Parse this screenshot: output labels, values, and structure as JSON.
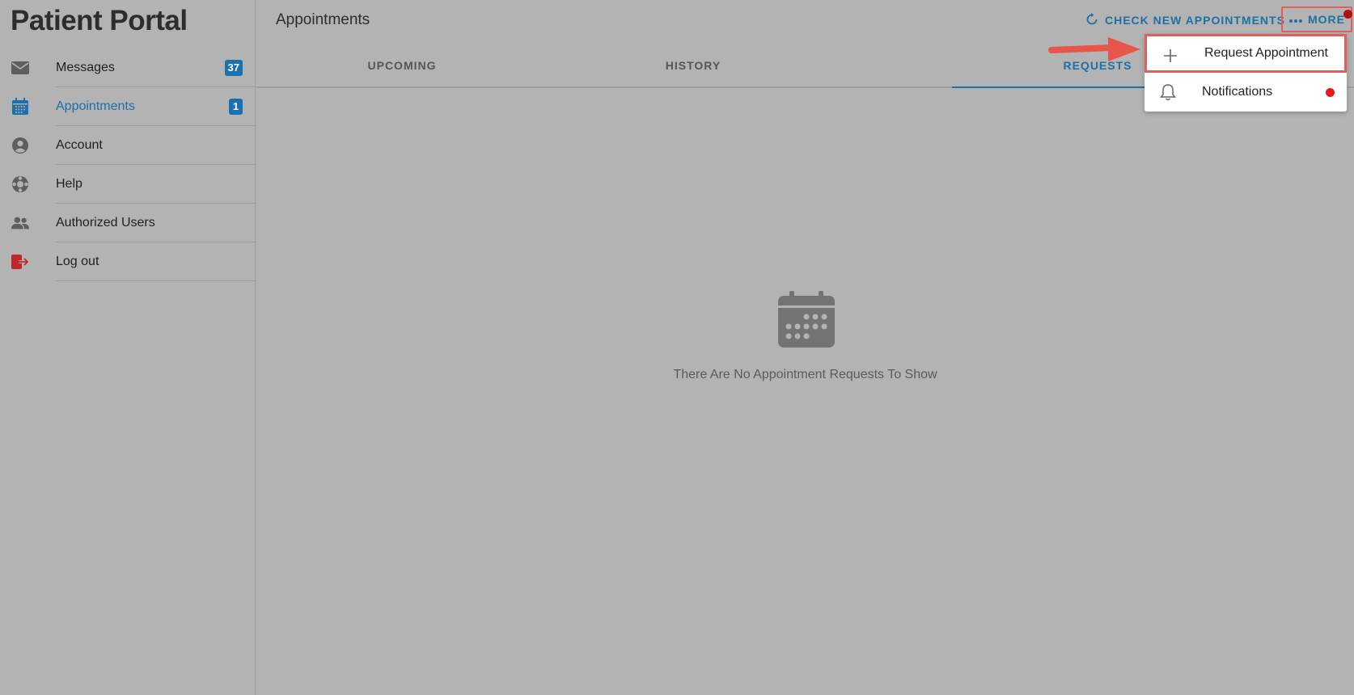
{
  "app": {
    "title": "Patient Portal"
  },
  "sidebar": {
    "items": [
      {
        "label": "Messages",
        "icon": "envelope-icon",
        "badge": "37",
        "active": false
      },
      {
        "label": "Appointments",
        "icon": "calendar-icon",
        "badge": "1",
        "active": true
      },
      {
        "label": "Account",
        "icon": "user-circle-icon",
        "badge": null,
        "active": false
      },
      {
        "label": "Help",
        "icon": "lifebuoy-icon",
        "badge": null,
        "active": false
      },
      {
        "label": "Authorized Users",
        "icon": "users-icon",
        "badge": null,
        "active": false
      },
      {
        "label": "Log out",
        "icon": "logout-icon",
        "badge": null,
        "active": false
      }
    ]
  },
  "header": {
    "title": "Appointments",
    "check_label": "CHECK NEW APPOINTMENTS",
    "more_label": "MORE"
  },
  "tabs": [
    {
      "label": "UPCOMING",
      "active": false
    },
    {
      "label": "HISTORY",
      "active": false
    },
    {
      "label": "REQUESTS",
      "active": true
    }
  ],
  "empty_state": {
    "icon": "calendar-icon",
    "message": "There Are No Appointment Requests To Show"
  },
  "dropdown": {
    "items": [
      {
        "label": "Request Appointment",
        "icon": "plus-icon"
      },
      {
        "label": "Notifications",
        "icon": "bell-icon",
        "indicator": true
      }
    ]
  },
  "colors": {
    "accent": "#1f6fa8",
    "badge": "#1c70ad",
    "logout": "#c0282e",
    "highlight": "#e06060",
    "notification_dot": "#e8161b",
    "overlay_bg": "#b3b3b3"
  }
}
